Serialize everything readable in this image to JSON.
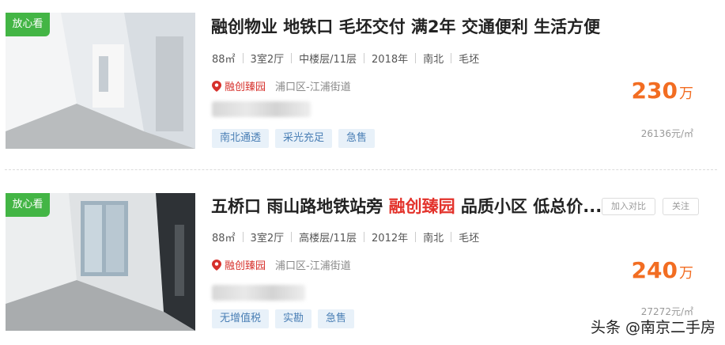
{
  "listings": [
    {
      "badge": "放心看",
      "title": "融创物业 地铁口 毛坯交付 满2年 交通便利 生活方便",
      "area": "88㎡",
      "layout": "3室2厅",
      "floor": "中楼层/11层",
      "year": "2018年",
      "orientation": "南北",
      "decoration": "毛坯",
      "community": "融创臻园",
      "district": "浦口区-江浦街道",
      "tags": [
        "南北通透",
        "采光充足",
        "急售"
      ],
      "price": "230",
      "price_unit": "万",
      "unit_price": "26136元/㎡"
    },
    {
      "badge": "放心看",
      "title_prefix": "五桥口 雨山路地铁站旁 ",
      "title_highlight": "融创臻园",
      "title_suffix": " 品质小区 低总价...",
      "compare_label": "加入对比",
      "follow_label": "关注",
      "area": "88㎡",
      "layout": "3室2厅",
      "floor": "高楼层/11层",
      "year": "2012年",
      "orientation": "南北",
      "decoration": "毛坯",
      "community": "融创臻园",
      "district": "浦口区-江浦街道",
      "tags": [
        "无增值税",
        "实勘",
        "急售"
      ],
      "price": "240",
      "price_unit": "万",
      "unit_price": "27272元/㎡"
    }
  ],
  "watermark": "头条 @南京二手房",
  "colors": {
    "badge": "#43b545",
    "price": "#f26d22",
    "highlight": "#e3322b",
    "tag_bg": "#e8f1f9",
    "tag_text": "#4a7fb5"
  }
}
